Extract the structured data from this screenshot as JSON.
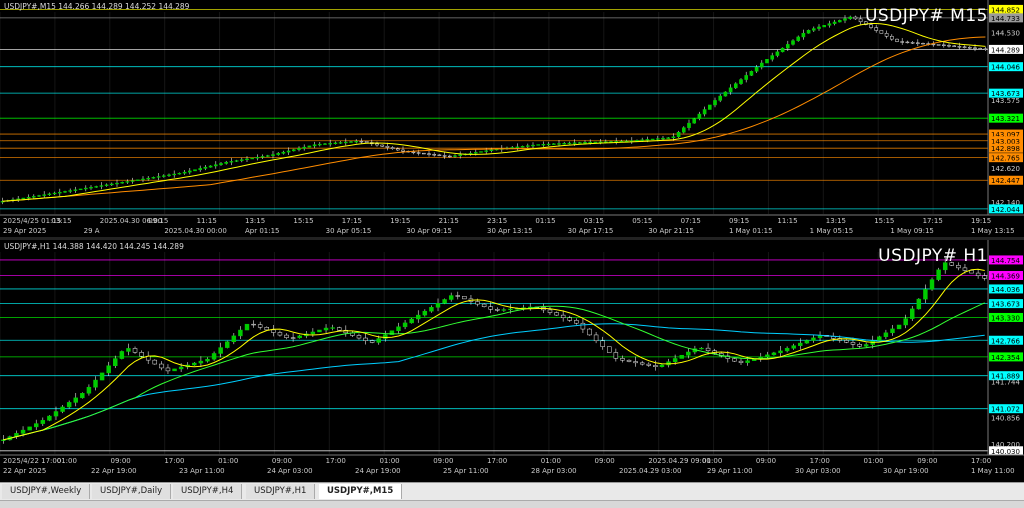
{
  "top_panel": {
    "header": "USDJPY#,M15  144.266 144.289 144.252 144.289",
    "symbol": "USDJPY# M15",
    "price_labels": [
      {
        "text": "144.852",
        "color": "#ffff00",
        "y": 144.852
      },
      {
        "text": "144.733",
        "color": "#9a9a9a",
        "y": 144.733
      },
      {
        "text": "144.530",
        "color": "none",
        "y": 144.53
      },
      {
        "text": "144.289",
        "color": "#ffffff",
        "y": 144.289
      },
      {
        "text": "144.046",
        "color": "#00ffff",
        "y": 144.046
      },
      {
        "text": "143.673",
        "color": "#00ffff",
        "y": 143.673
      },
      {
        "text": "143.575",
        "color": "none",
        "y": 143.575
      },
      {
        "text": "143.321",
        "color": "#00ff00",
        "y": 143.321
      },
      {
        "text": "143.097",
        "color": "#ff8c00",
        "y": 143.097
      },
      {
        "text": "143.003",
        "color": "#ff8c00",
        "y": 143.003
      },
      {
        "text": "142.898",
        "color": "#ff8c00",
        "y": 142.898
      },
      {
        "text": "142.765",
        "color": "#ff8c00",
        "y": 142.765
      },
      {
        "text": "142.620",
        "color": "none",
        "y": 142.62
      },
      {
        "text": "142.447",
        "color": "#ff8c00",
        "y": 142.447
      },
      {
        "text": "142.140",
        "color": "none",
        "y": 142.14
      },
      {
        "text": "142.044",
        "color": "#00ffff",
        "y": 142.044
      }
    ],
    "time_labels": [
      "2025/4/25 01:15",
      "03:15",
      "2025.04.30 06:00",
      "09:15",
      "11:15",
      "13:15",
      "15:15",
      "17:15",
      "19:15",
      "21:15",
      "23:15",
      "01:15",
      "03:15",
      "05:15",
      "07:15",
      "09:15",
      "11:15",
      "13:15",
      "15:15",
      "17:15",
      "19:15"
    ],
    "date_labels": [
      "29 Apr 2025",
      "29 A",
      "2025.04.30 00:00",
      "Apr 01:15",
      "30 Apr 05:15",
      "30 Apr 09:15",
      "30 Apr 13:15",
      "30 Apr 17:15",
      "30 Apr 21:15",
      "1 May 01:15",
      "1 May 05:15",
      "1 May 09:15",
      "1 May 13:15"
    ]
  },
  "bottom_panel": {
    "header": "USDJPY#,H1  144.388 144.420 144.245 144.289",
    "symbol": "USDJPY# H1",
    "price_labels": [
      {
        "text": "144.754",
        "color": "#ff00ff",
        "y": 144.754
      },
      {
        "text": "144.369",
        "color": "#ff00ff",
        "y": 144.369
      },
      {
        "text": "144.036",
        "color": "#00ffff",
        "y": 144.036
      },
      {
        "text": "143.673",
        "color": "#00ffff",
        "y": 143.673
      },
      {
        "text": "143.330",
        "color": "#00ff00",
        "y": 143.33
      },
      {
        "text": "142.766",
        "color": "#00ffff",
        "y": 142.766
      },
      {
        "text": "142.354",
        "color": "#00ff00",
        "y": 142.354
      },
      {
        "text": "141.889",
        "color": "#00ffff",
        "y": 141.889
      },
      {
        "text": "141.744",
        "color": "none",
        "y": 141.744
      },
      {
        "text": "141.072",
        "color": "#00ffff",
        "y": 141.072
      },
      {
        "text": "140.856",
        "color": "none",
        "y": 140.856
      },
      {
        "text": "140.200",
        "color": "none",
        "y": 140.2
      },
      {
        "text": "140.030",
        "color": "#ffffff",
        "y": 140.03
      }
    ],
    "time_labels": [
      "2025/4/22 17:00",
      "01:00",
      "09:00",
      "17:00",
      "01:00",
      "09:00",
      "17:00",
      "01:00",
      "09:00",
      "17:00",
      "01:00",
      "09:00",
      "2025.04.29 09:00",
      "01:00",
      "09:00",
      "17:00",
      "01:00",
      "09:00",
      "17:00"
    ],
    "date_labels": [
      "22 Apr 2025",
      "22 Apr 19:00",
      "23 Apr 11:00",
      "24 Apr 03:00",
      "24 Apr 19:00",
      "25 Apr 11:00",
      "28 Apr 03:00",
      "2025.04.29 03:00",
      "29 Apr 11:00",
      "30 Apr 03:00",
      "30 Apr 19:00",
      "1 May 11:00"
    ]
  },
  "tabs": [
    {
      "label": "USDJPY#,Weekly",
      "active": false
    },
    {
      "label": "USDJPY#,Daily",
      "active": false
    },
    {
      "label": "USDJPY#,H4",
      "active": false
    },
    {
      "label": "USDJPY#,H1",
      "active": false
    },
    {
      "label": "USDJPY#,M15",
      "active": true
    }
  ]
}
